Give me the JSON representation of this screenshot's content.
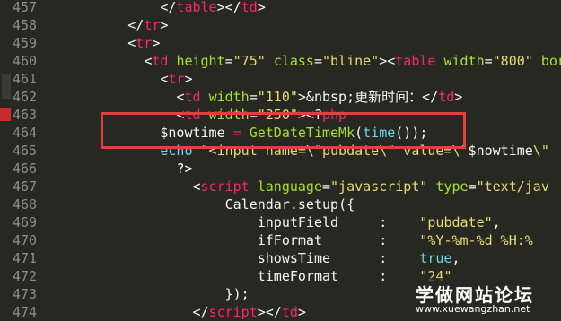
{
  "editor": {
    "lines": [
      {
        "num": "457",
        "segments": [
          {
            "t": "            ",
            "c": "plain"
          },
          {
            "t": "</",
            "c": "plain"
          },
          {
            "t": "table",
            "c": "tag"
          },
          {
            "t": "></",
            "c": "plain"
          },
          {
            "t": "td",
            "c": "tag"
          },
          {
            "t": ">",
            "c": "plain"
          }
        ]
      },
      {
        "num": "458",
        "segments": [
          {
            "t": "        ",
            "c": "plain"
          },
          {
            "t": "</",
            "c": "plain"
          },
          {
            "t": "tr",
            "c": "tag"
          },
          {
            "t": ">",
            "c": "plain"
          }
        ]
      },
      {
        "num": "459",
        "segments": [
          {
            "t": "        ",
            "c": "plain"
          },
          {
            "t": "<",
            "c": "plain"
          },
          {
            "t": "tr",
            "c": "tag"
          },
          {
            "t": ">",
            "c": "plain"
          }
        ]
      },
      {
        "num": "460",
        "segments": [
          {
            "t": "          ",
            "c": "plain"
          },
          {
            "t": "<",
            "c": "plain"
          },
          {
            "t": "td ",
            "c": "tag"
          },
          {
            "t": "height",
            "c": "attr"
          },
          {
            "t": "=",
            "c": "plain"
          },
          {
            "t": "\"75\"",
            "c": "str"
          },
          {
            "t": " ",
            "c": "plain"
          },
          {
            "t": "class",
            "c": "attr"
          },
          {
            "t": "=",
            "c": "plain"
          },
          {
            "t": "\"bline\"",
            "c": "str"
          },
          {
            "t": "><",
            "c": "plain"
          },
          {
            "t": "table ",
            "c": "tag"
          },
          {
            "t": "width",
            "c": "attr"
          },
          {
            "t": "=",
            "c": "plain"
          },
          {
            "t": "\"800\"",
            "c": "str"
          },
          {
            "t": " bor",
            "c": "attr"
          }
        ]
      },
      {
        "num": "461",
        "segments": [
          {
            "t": "            ",
            "c": "plain"
          },
          {
            "t": "<",
            "c": "plain"
          },
          {
            "t": "tr",
            "c": "tag"
          },
          {
            "t": ">",
            "c": "plain"
          }
        ]
      },
      {
        "num": "462",
        "segments": [
          {
            "t": "              ",
            "c": "plain"
          },
          {
            "t": "<",
            "c": "plain"
          },
          {
            "t": "td ",
            "c": "tag"
          },
          {
            "t": "width",
            "c": "attr"
          },
          {
            "t": "=",
            "c": "plain"
          },
          {
            "t": "\"110\"",
            "c": "str"
          },
          {
            "t": ">&nbsp;",
            "c": "plain"
          },
          {
            "t": "更新时间：",
            "c": "plain cjk"
          },
          {
            "t": "</",
            "c": "plain"
          },
          {
            "t": "td",
            "c": "tag"
          },
          {
            "t": ">",
            "c": "plain"
          }
        ]
      },
      {
        "num": "463",
        "segments": [
          {
            "t": "              ",
            "c": "plain"
          },
          {
            "t": "<",
            "c": "plain"
          },
          {
            "t": "td ",
            "c": "tag"
          },
          {
            "t": "width",
            "c": "attr"
          },
          {
            "t": "=",
            "c": "plain"
          },
          {
            "t": "\"250\"",
            "c": "str"
          },
          {
            "t": "><?",
            "c": "plain"
          },
          {
            "t": "php",
            "c": "tag"
          }
        ]
      },
      {
        "num": "464",
        "segments": [
          {
            "t": "            ",
            "c": "plain"
          },
          {
            "t": "$nowtime",
            "c": "plain"
          },
          {
            "t": " = ",
            "c": "op"
          },
          {
            "t": "GetDateTimeMk",
            "c": "attr"
          },
          {
            "t": "(",
            "c": "plain"
          },
          {
            "t": "time",
            "c": "fn"
          },
          {
            "t": "());",
            "c": "plain"
          }
        ]
      },
      {
        "num": "465",
        "segments": [
          {
            "t": "            ",
            "c": "plain"
          },
          {
            "t": "echo",
            "c": "fn"
          },
          {
            "t": " ",
            "c": "plain"
          },
          {
            "t": "\"<input name=\\\"pubdate\\\" value=\\\"",
            "c": "str"
          },
          {
            "t": "$nowtime",
            "c": "plain"
          },
          {
            "t": "\\\"",
            "c": "str"
          }
        ]
      },
      {
        "num": "466",
        "segments": [
          {
            "t": "              ",
            "c": "plain"
          },
          {
            "t": "?>",
            "c": "plain"
          }
        ]
      },
      {
        "num": "467",
        "segments": [
          {
            "t": "                ",
            "c": "plain"
          },
          {
            "t": "<",
            "c": "plain"
          },
          {
            "t": "script ",
            "c": "tag"
          },
          {
            "t": "language",
            "c": "attr"
          },
          {
            "t": "=",
            "c": "plain"
          },
          {
            "t": "\"javascript\"",
            "c": "str"
          },
          {
            "t": " ",
            "c": "plain"
          },
          {
            "t": "type",
            "c": "attr"
          },
          {
            "t": "=",
            "c": "plain"
          },
          {
            "t": "\"text/jav",
            "c": "str"
          }
        ]
      },
      {
        "num": "468",
        "segments": [
          {
            "t": "                    ",
            "c": "plain"
          },
          {
            "t": "Calendar",
            "c": "plain"
          },
          {
            "t": ".",
            "c": "plain"
          },
          {
            "t": "setup",
            "c": "plain"
          },
          {
            "t": "({",
            "c": "plain"
          }
        ]
      },
      {
        "num": "469",
        "segments": [
          {
            "t": "                        ",
            "c": "plain"
          },
          {
            "t": "inputField     ",
            "c": "plain"
          },
          {
            "t": ":",
            "c": "plain"
          },
          {
            "t": "    ",
            "c": "plain"
          },
          {
            "t": "\"pubdate\"",
            "c": "str"
          },
          {
            "t": ",",
            "c": "plain"
          }
        ]
      },
      {
        "num": "470",
        "segments": [
          {
            "t": "                        ",
            "c": "plain"
          },
          {
            "t": "ifFormat       ",
            "c": "plain"
          },
          {
            "t": ":",
            "c": "plain"
          },
          {
            "t": "    ",
            "c": "plain"
          },
          {
            "t": "\"%Y-%m-%d %H:%",
            "c": "str"
          }
        ]
      },
      {
        "num": "471",
        "segments": [
          {
            "t": "                        ",
            "c": "plain"
          },
          {
            "t": "showsTime      ",
            "c": "plain"
          },
          {
            "t": ":",
            "c": "plain"
          },
          {
            "t": "    ",
            "c": "plain"
          },
          {
            "t": "true",
            "c": "fn"
          },
          {
            "t": ",",
            "c": "plain"
          }
        ]
      },
      {
        "num": "472",
        "segments": [
          {
            "t": "                        ",
            "c": "plain"
          },
          {
            "t": "timeFormat     ",
            "c": "plain"
          },
          {
            "t": ":",
            "c": "plain"
          },
          {
            "t": "    ",
            "c": "plain"
          },
          {
            "t": "\"24\"",
            "c": "str"
          }
        ]
      },
      {
        "num": "473",
        "segments": [
          {
            "t": "                    ",
            "c": "plain"
          },
          {
            "t": "});",
            "c": "plain"
          }
        ]
      },
      {
        "num": "474",
        "segments": [
          {
            "t": "                ",
            "c": "plain"
          },
          {
            "t": "</",
            "c": "plain"
          },
          {
            "t": "script",
            "c": "tag"
          },
          {
            "t": "></",
            "c": "plain"
          },
          {
            "t": "td",
            "c": "tag"
          },
          {
            "t": ">",
            "c": "plain"
          }
        ]
      }
    ]
  },
  "watermark": {
    "title": "学做网站论坛",
    "url": "www.xuewangzhan.net"
  },
  "colors": {
    "background": "#272822",
    "highlight_box": "#e0403f"
  }
}
